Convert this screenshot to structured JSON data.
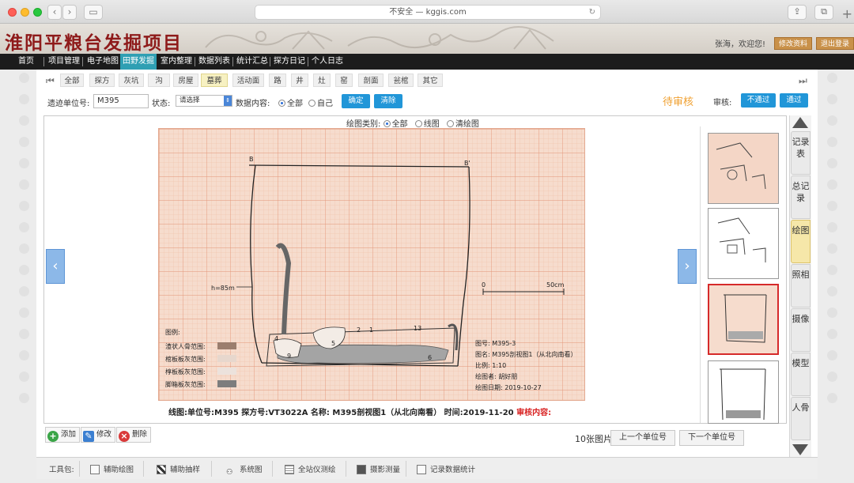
{
  "browser": {
    "url_prefix": "不安全 —",
    "url": "kggis.com"
  },
  "header": {
    "title": "淮阳平粮台发掘项目",
    "welcome": "张海，欢迎您!",
    "edit_profile": "修改资料",
    "logout": "退出登录"
  },
  "nav": [
    "首页",
    "项目管理",
    "电子地图",
    "田野发掘",
    "室内整理",
    "数据列表",
    "统计汇总",
    "探方日记",
    "个人日志"
  ],
  "categories": [
    "全部",
    "探方",
    "灰坑",
    "沟",
    "房屋",
    "墓葬",
    "活动面",
    "路",
    "井",
    "灶",
    "窑",
    "剖面",
    "瓮棺",
    "其它"
  ],
  "filters": {
    "unit_label": "遗迹单位号:",
    "unit_value": "M395",
    "status_label": "状态:",
    "status_value": "请选择",
    "content_label": "数据内容:",
    "content_all": "全部",
    "content_self": "自己",
    "confirm": "确定",
    "clear": "清除",
    "pending": "待审核",
    "review_label": "审核:",
    "reject": "不通过",
    "approve": "通过"
  },
  "viewer": {
    "type_label": "绘图类别:",
    "type_all": "全部",
    "type_line": "线图",
    "type_clean": "清绘图"
  },
  "drawing": {
    "label_b": "B",
    "label_b2": "B'",
    "depth": "h=85m",
    "scale_zero": "0",
    "scale_len": "50cm",
    "nums": [
      "2",
      "1",
      "13",
      "4",
      "5",
      "9",
      "6"
    ],
    "legend_title": "图例:",
    "legend_items": [
      "渣状人骨范围:",
      "棺板板灰范围:",
      "椁板板灰范围:",
      "脚箱板灰范围:"
    ],
    "legend_colors": [
      "#9b7e6e",
      "#e7d7cd",
      "#ece2dc",
      "#7d7d7d"
    ],
    "info": [
      "图号: M395-3",
      "图名: M395剖视图1（从北向南看）",
      "比例: 1:10",
      "绘图者: 胡好朋",
      "绘图日期: 2019-10-27"
    ]
  },
  "caption": {
    "text": "线图:单位号:M395   探方号:VT3022A  名称: M395剖视图1（从北向南看）   时间:2019-11-20",
    "review": "审核内容:"
  },
  "right_tabs": [
    "记录表",
    "总记录",
    "绘图",
    "照相",
    "摄像",
    "模型",
    "人骨"
  ],
  "actions": {
    "add": "添加",
    "edit": "修改",
    "delete": "删除"
  },
  "pager": {
    "count": "10张图片",
    "prev": "上一个单位号",
    "next": "下一个单位号"
  },
  "toolbar": {
    "label": "工具包:",
    "items": [
      "辅助绘图",
      "辅助抽样",
      "系统图",
      "全站仪测绘",
      "摄影测量",
      "记录数据统计"
    ]
  }
}
